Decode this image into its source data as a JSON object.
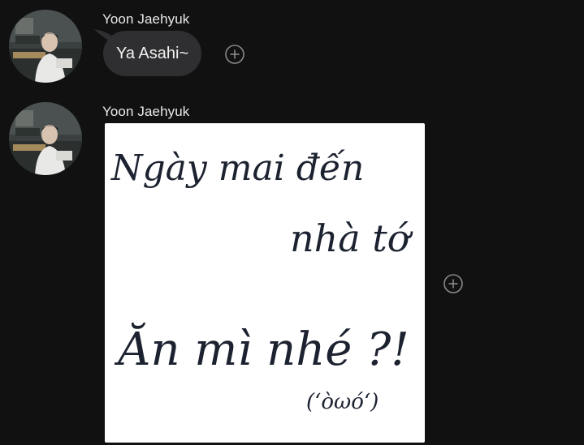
{
  "messages": [
    {
      "sender": "Yoon Jaehyuk",
      "text": "Ya Asahi~"
    },
    {
      "sender": "Yoon Jaehyuk",
      "note_lines": [
        "Ngày mai đến",
        "nhà tớ",
        "Ăn mì nhé ?!",
        "(ʻòωóʻ)"
      ]
    }
  ],
  "icons": {
    "avatar": "profile-photo",
    "react": "add-reaction-icon"
  },
  "colors": {
    "background": "#111112",
    "bubble": "#2f2f31",
    "text": "#ffffff",
    "ink": "#1c2230"
  }
}
